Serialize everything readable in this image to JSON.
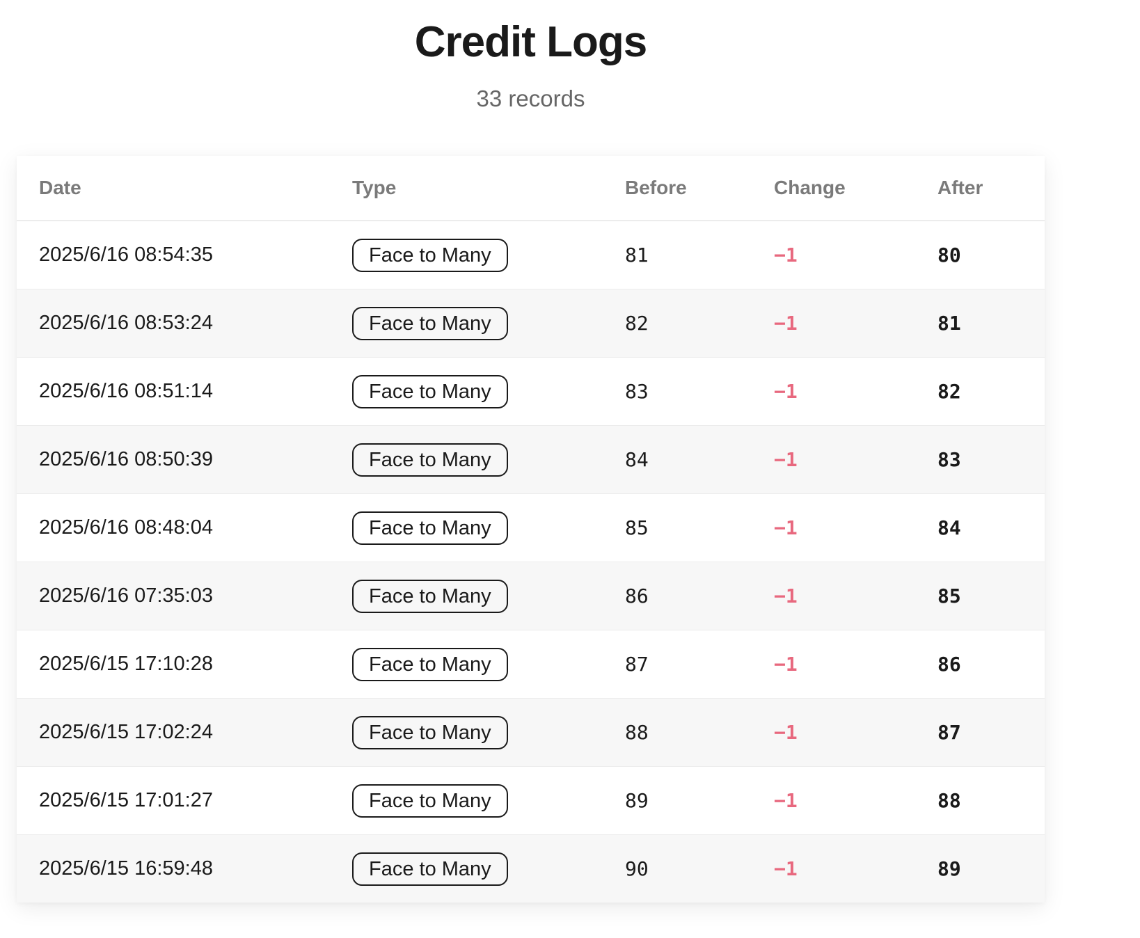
{
  "header": {
    "title": "Credit Logs",
    "record_count": "33 records"
  },
  "table": {
    "columns": {
      "date": "Date",
      "type": "Type",
      "before": "Before",
      "change": "Change",
      "after": "After"
    },
    "rows": [
      {
        "date": "2025/6/16 08:54:35",
        "type": "Face to Many",
        "before": "81",
        "change": "−1",
        "after": "80"
      },
      {
        "date": "2025/6/16 08:53:24",
        "type": "Face to Many",
        "before": "82",
        "change": "−1",
        "after": "81"
      },
      {
        "date": "2025/6/16 08:51:14",
        "type": "Face to Many",
        "before": "83",
        "change": "−1",
        "after": "82"
      },
      {
        "date": "2025/6/16 08:50:39",
        "type": "Face to Many",
        "before": "84",
        "change": "−1",
        "after": "83"
      },
      {
        "date": "2025/6/16 08:48:04",
        "type": "Face to Many",
        "before": "85",
        "change": "−1",
        "after": "84"
      },
      {
        "date": "2025/6/16 07:35:03",
        "type": "Face to Many",
        "before": "86",
        "change": "−1",
        "after": "85"
      },
      {
        "date": "2025/6/15 17:10:28",
        "type": "Face to Many",
        "before": "87",
        "change": "−1",
        "after": "86"
      },
      {
        "date": "2025/6/15 17:02:24",
        "type": "Face to Many",
        "before": "88",
        "change": "−1",
        "after": "87"
      },
      {
        "date": "2025/6/15 17:01:27",
        "type": "Face to Many",
        "before": "89",
        "change": "−1",
        "after": "88"
      },
      {
        "date": "2025/6/15 16:59:48",
        "type": "Face to Many",
        "before": "90",
        "change": "−1",
        "after": "89"
      }
    ]
  },
  "colors": {
    "negative_change": "#e8687e",
    "header_text": "#7a7a7a",
    "striped_row": "#f7f7f7"
  }
}
